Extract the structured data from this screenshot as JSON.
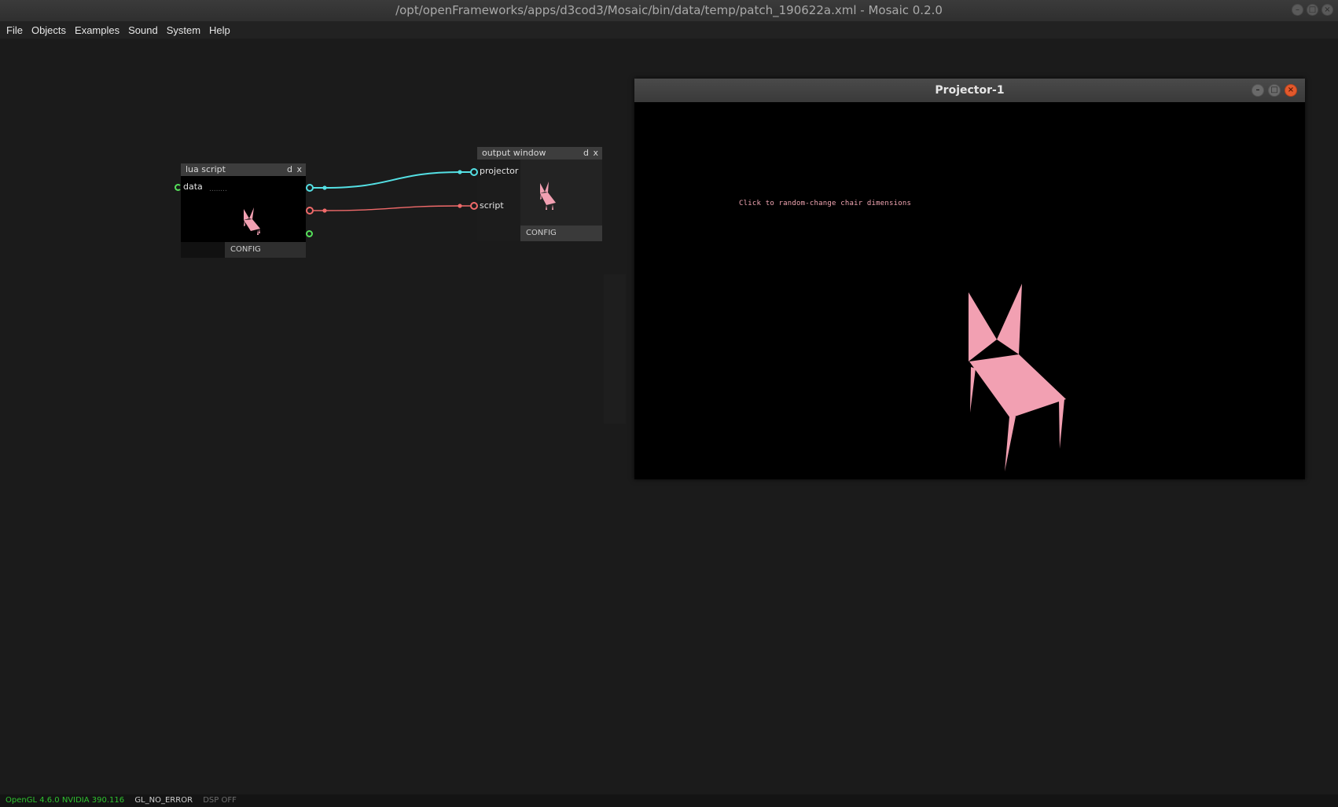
{
  "window": {
    "title": "/opt/openFrameworks/apps/d3cod3/Mosaic/bin/data/temp/patch_190622a.xml - Mosaic 0.2.0"
  },
  "menu": {
    "items": [
      "File",
      "Objects",
      "Examples",
      "Sound",
      "System",
      "Help"
    ]
  },
  "nodes": {
    "lua_script": {
      "title": "lua script",
      "btn_d": "d",
      "btn_x": "x",
      "inlet_label": "data",
      "inlet_hint": "........",
      "config_label": "CONFIG"
    },
    "output_window": {
      "title": "output window",
      "btn_d": "d",
      "btn_x": "x",
      "inlet_1_label": "projector",
      "inlet_2_label": "script",
      "inlet_hint": "...",
      "config_label": "CONFIG"
    }
  },
  "cables": [
    {
      "from": "lua_script",
      "to": "output_window.projector",
      "color": "#54e0e4"
    },
    {
      "from": "lua_script",
      "to": "output_window.script",
      "color": "#f06a6a"
    }
  ],
  "projector_window": {
    "title": "Projector-1",
    "hint_text": "Click to random-change chair dimensions",
    "chair_color": "#f2a0b2"
  },
  "status": {
    "gl_version": "OpenGL 4.6.0 NVIDIA 390.116",
    "gl_error": "GL_NO_ERROR",
    "dsp": "DSP OFF"
  },
  "colors": {
    "background": "#1b1b1b",
    "cable_texture": "#54e0e4",
    "cable_script": "#f06a6a",
    "pin_data": "#55e05a",
    "gl_ok": "#2ec12e"
  }
}
